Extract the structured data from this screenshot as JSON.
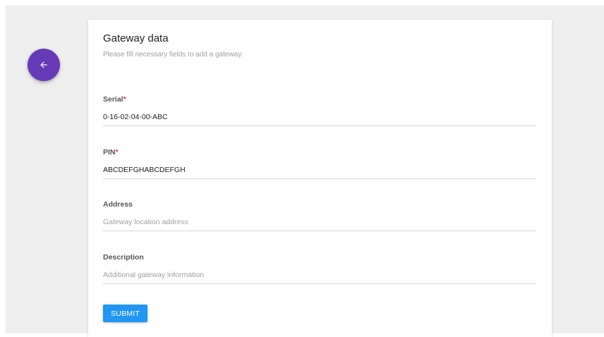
{
  "nav": {
    "back_icon": "arrow-left-icon",
    "back_color": "#673ab7"
  },
  "card": {
    "title": "Gateway data",
    "subtitle": "Please fill necessary fields to add a gateway."
  },
  "fields": [
    {
      "label": "Serial",
      "required": true,
      "value": "0-16-02-04-00-ABC",
      "placeholder": ""
    },
    {
      "label": "PIN",
      "required": true,
      "value": "ABCDEFGHABCDEFGH",
      "placeholder": ""
    },
    {
      "label": "Address",
      "required": false,
      "value": "",
      "placeholder": "Gateway location address"
    },
    {
      "label": "Description",
      "required": false,
      "value": "",
      "placeholder": "Additional gateway information"
    }
  ],
  "required_marker": "*",
  "submit": {
    "label": "SUBMIT",
    "color": "#2196f3"
  }
}
